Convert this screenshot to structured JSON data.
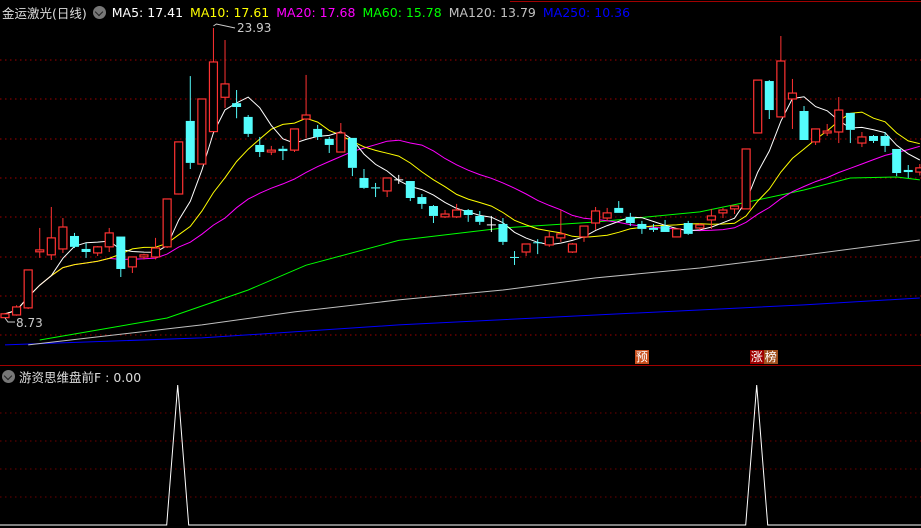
{
  "header": {
    "title": "金运激光(日线)",
    "ma_labels": [
      {
        "text": "MA5: 17.41",
        "color": "#ffffff"
      },
      {
        "text": "MA10: 17.61",
        "color": "#ffff00"
      },
      {
        "text": "MA20: 17.68",
        "color": "#ff00ff"
      },
      {
        "text": "MA60: 15.78",
        "color": "#00ff00"
      },
      {
        "text": "MA120: 13.79",
        "color": "#c0c0c0"
      },
      {
        "text": "MA250: 10.36",
        "color": "#0000ff"
      }
    ]
  },
  "indicator": {
    "label": "游资思维盘前F : 0.00"
  },
  "markers": {
    "pre": "预",
    "limit_a": "涨",
    "limit_b": "榜"
  },
  "colors": {
    "up": "#ff3232",
    "down": "#54fcfc",
    "grid": "#8b0000",
    "bg": "#000000"
  },
  "chart_data": {
    "type": "candlestick",
    "price_range": [
      7.0,
      24.4
    ],
    "high_label": "23.93",
    "low_label": "8.73",
    "candles": [
      [
        8.75,
        9.0,
        8.73,
        8.95
      ],
      [
        8.89,
        9.4,
        8.85,
        9.31
      ],
      [
        9.26,
        11.25,
        9.2,
        11.25
      ],
      [
        12.2,
        13.45,
        11.88,
        12.3
      ],
      [
        12.04,
        14.55,
        11.77,
        12.93
      ],
      [
        12.35,
        13.97,
        12.14,
        13.5
      ],
      [
        13.03,
        13.19,
        12.4,
        12.46
      ],
      [
        12.35,
        12.66,
        11.88,
        12.19
      ],
      [
        12.14,
        12.5,
        11.98,
        12.46
      ],
      [
        12.46,
        13.45,
        12.19,
        13.19
      ],
      [
        13.0,
        13.0,
        10.88,
        11.3
      ],
      [
        11.41,
        11.93,
        11.09,
        11.93
      ],
      [
        11.93,
        12.1,
        11.8,
        12.04
      ],
      [
        11.93,
        12.93,
        11.8,
        12.4
      ],
      [
        12.46,
        14.97,
        12.4,
        14.97
      ],
      [
        15.23,
        17.96,
        15.2,
        17.96
      ],
      [
        19.06,
        21.41,
        16.54,
        16.86
      ],
      [
        16.8,
        20.21,
        16.8,
        20.21
      ],
      [
        18.5,
        23.93,
        19.27,
        22.15
      ],
      [
        20.3,
        23.3,
        19.74,
        21.0
      ],
      [
        19.99,
        20.68,
        19.2,
        19.79
      ],
      [
        19.27,
        19.37,
        18.22,
        18.38
      ],
      [
        17.8,
        18.22,
        17.17,
        17.43
      ],
      [
        17.43,
        17.75,
        17.27,
        17.53
      ],
      [
        17.6,
        17.75,
        17.01,
        17.48
      ],
      [
        17.53,
        18.64,
        17.43,
        18.64
      ],
      [
        19.16,
        21.47,
        18.17,
        19.37
      ],
      [
        18.64,
        18.85,
        18.06,
        18.22
      ],
      [
        18.12,
        18.22,
        17.38,
        17.8
      ],
      [
        17.43,
        18.95,
        17.43,
        18.43
      ],
      [
        18.17,
        18.17,
        16.17,
        16.6
      ],
      [
        16.07,
        16.54,
        15.5,
        15.55
      ],
      [
        15.58,
        15.81,
        15.07,
        15.52
      ],
      [
        15.39,
        16.07,
        15.07,
        16.07
      ],
      [
        15.97,
        16.23,
        15.76,
        15.97
      ],
      [
        15.91,
        15.91,
        14.86,
        15.02
      ],
      [
        15.07,
        15.23,
        14.45,
        14.71
      ],
      [
        14.6,
        14.65,
        13.71,
        14.08
      ],
      [
        14.03,
        14.39,
        13.97,
        14.18
      ],
      [
        14.03,
        14.71,
        13.97,
        14.39
      ],
      [
        14.39,
        14.44,
        13.77,
        14.13
      ],
      [
        14.08,
        14.34,
        13.61,
        13.77
      ],
      [
        13.61,
        14.08,
        13.24,
        13.61
      ],
      [
        13.66,
        13.97,
        12.56,
        12.72
      ],
      [
        11.93,
        12.24,
        11.51,
        11.88
      ],
      [
        12.19,
        12.61,
        11.98,
        12.61
      ],
      [
        12.7,
        12.86,
        12.08,
        12.66
      ],
      [
        12.56,
        13.24,
        12.46,
        12.98
      ],
      [
        12.93,
        14.39,
        12.72,
        13.14
      ],
      [
        12.19,
        12.66,
        12.14,
        12.61
      ],
      [
        12.98,
        13.55,
        12.72,
        13.55
      ],
      [
        13.71,
        14.55,
        13.35,
        14.34
      ],
      [
        13.97,
        14.5,
        13.82,
        14.24
      ],
      [
        14.5,
        14.86,
        14.24,
        14.24
      ],
      [
        14.03,
        14.24,
        13.55,
        13.71
      ],
      [
        13.66,
        13.82,
        13.14,
        13.4
      ],
      [
        13.45,
        13.66,
        13.24,
        13.35
      ],
      [
        13.55,
        13.87,
        13.24,
        13.24
      ],
      [
        12.98,
        13.4,
        12.98,
        13.4
      ],
      [
        13.71,
        13.82,
        13.09,
        13.14
      ],
      [
        13.45,
        13.71,
        13.35,
        13.61
      ],
      [
        13.87,
        14.45,
        13.4,
        14.08
      ],
      [
        14.24,
        14.5,
        13.97,
        14.39
      ],
      [
        14.45,
        14.6,
        14.18,
        14.6
      ],
      [
        14.45,
        17.59,
        14.45,
        17.59
      ],
      [
        18.43,
        21.2,
        18.43,
        21.2
      ],
      [
        21.15,
        21.2,
        19.16,
        19.63
      ],
      [
        19.27,
        23.51,
        19.27,
        22.2
      ],
      [
        20.21,
        21.26,
        18.64,
        20.52
      ],
      [
        19.58,
        19.84,
        18.06,
        18.06
      ],
      [
        17.96,
        18.64,
        17.8,
        18.64
      ],
      [
        18.43,
        18.9,
        18.27,
        18.53
      ],
      [
        18.48,
        20.31,
        17.9,
        19.63
      ],
      [
        19.48,
        19.48,
        17.9,
        18.59
      ],
      [
        17.9,
        18.48,
        17.69,
        18.22
      ],
      [
        18.27,
        18.32,
        17.9,
        18.01
      ],
      [
        18.27,
        18.48,
        17.43,
        17.75
      ],
      [
        17.59,
        17.59,
        16.17,
        16.33
      ],
      [
        16.49,
        16.75,
        16.07,
        16.38
      ],
      [
        16.38,
        16.8,
        16.2,
        16.6
      ]
    ],
    "ma_periods_computed": [
      5,
      10,
      20
    ],
    "ma_colors": {
      "MA5": "#ffffff",
      "MA10": "#ffff00",
      "MA20": "#ff00ff",
      "MA60": "#00ff00",
      "MA120": "#c0c0c0",
      "MA250": "#0000ff"
    },
    "ma60": [
      [
        3,
        7.58
      ],
      [
        8,
        8.1
      ],
      [
        14,
        8.73
      ],
      [
        21,
        10.2
      ],
      [
        26,
        11.5
      ],
      [
        34,
        12.8
      ],
      [
        43,
        13.45
      ],
      [
        51,
        13.76
      ],
      [
        60,
        14.29
      ],
      [
        65,
        14.92
      ],
      [
        69,
        15.44
      ],
      [
        73,
        16.07
      ],
      [
        77,
        16.12
      ],
      [
        79,
        15.97
      ]
    ],
    "ma120": [
      [
        2,
        7.32
      ],
      [
        8,
        7.74
      ],
      [
        17,
        8.37
      ],
      [
        25,
        9.05
      ],
      [
        34,
        9.68
      ],
      [
        43,
        10.2
      ],
      [
        51,
        10.83
      ],
      [
        60,
        11.35
      ],
      [
        69,
        12.03
      ],
      [
        79,
        12.82
      ]
    ],
    "ma250": [
      [
        0,
        7.32
      ],
      [
        17,
        7.69
      ],
      [
        34,
        8.37
      ],
      [
        51,
        8.89
      ],
      [
        69,
        9.42
      ],
      [
        79,
        9.78
      ]
    ],
    "indicator_values": {
      "spike_indices": [
        15,
        65
      ],
      "range": [
        0,
        1
      ]
    },
    "marker_indices": {
      "pre": 55,
      "limit": 65
    }
  }
}
